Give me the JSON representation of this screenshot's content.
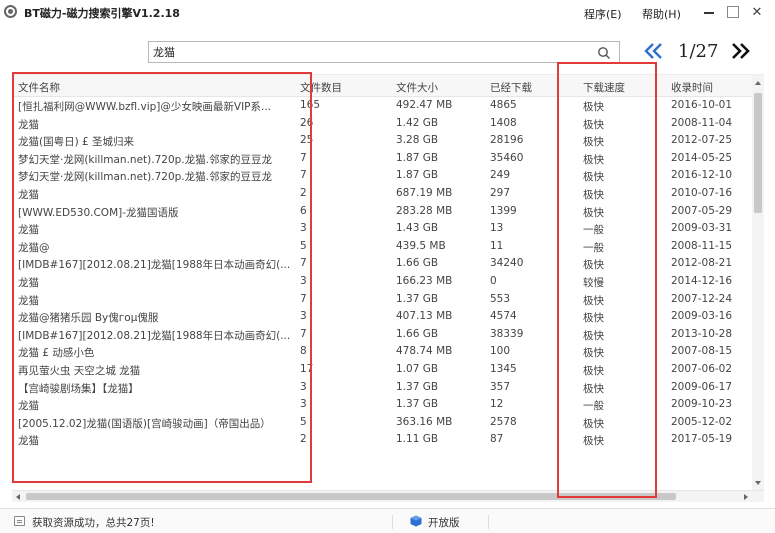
{
  "app": {
    "title": "BT磁力-磁力搜索引擎V1.2.18",
    "menu_program": "程序(E)",
    "menu_help": "帮助(H)",
    "close_glyph": "✕"
  },
  "search": {
    "value": "龙猫",
    "placeholder": ""
  },
  "pagination": {
    "label": "1/27",
    "prev_glyph": "«",
    "next_glyph": "»"
  },
  "colors": {
    "accent": "#2f6fd0",
    "annotation": "#e23a3a"
  },
  "table": {
    "headers": [
      "文件名称",
      "文件数目",
      "文件大小",
      "已经下载",
      "下载速度",
      "收录时间"
    ],
    "rows": [
      [
        "[恒扎福利网@WWW.bzfl.vip]@少女映画最新VIP系...",
        "165",
        "492.47 MB",
        "4865",
        "极快",
        "2016-10-01"
      ],
      [
        "龙猫",
        "26",
        "1.42 GB",
        "1408",
        "极快",
        "2008-11-04"
      ],
      [
        "龙猫(国粤日) £ 圣城归来",
        "25",
        "3.28 GB",
        "28196",
        "极快",
        "2012-07-25"
      ],
      [
        "梦幻天堂·龙网(killman.net).720p.龙猫.邻家的豆豆龙",
        "7",
        "1.87 GB",
        "35460",
        "极快",
        "2014-05-25"
      ],
      [
        "梦幻天堂·龙网(killman.net).720p.龙猫.邻家的豆豆龙",
        "7",
        "1.87 GB",
        "249",
        "极快",
        "2016-12-10"
      ],
      [
        "龙猫",
        "2",
        "687.19 MB",
        "297",
        "极快",
        "2010-07-16"
      ],
      [
        "[WWW.ED530.COM]-龙猫国语版",
        "6",
        "283.28 MB",
        "1399",
        "极快",
        "2007-05-29"
      ],
      [
        "龙猫",
        "3",
        "1.43 GB",
        "13",
        "一般",
        "2009-03-31"
      ],
      [
        "龙猫@",
        "5",
        "439.5 MB",
        "11",
        "一般",
        "2008-11-15"
      ],
      [
        "[IMDB#167][2012.08.21]龙猫[1988年日本动画奇幻(...",
        "7",
        "1.66 GB",
        "34240",
        "极快",
        "2012-08-21"
      ],
      [
        "龙猫",
        "3",
        "166.23 MB",
        "0",
        "较慢",
        "2014-12-16"
      ],
      [
        "龙猫",
        "7",
        "1.37 GB",
        "553",
        "极快",
        "2007-12-24"
      ],
      [
        "龙猫@猪猪乐园 By傀гоμ傀服",
        "3",
        "407.13 MB",
        "4574",
        "极快",
        "2009-03-16"
      ],
      [
        "[IMDB#167][2012.08.21]龙猫[1988年日本动画奇幻(...",
        "7",
        "1.66 GB",
        "38339",
        "极快",
        "2013-10-28"
      ],
      [
        "龙猫 £ 动感小色",
        "8",
        "478.74 MB",
        "100",
        "极快",
        "2007-08-15"
      ],
      [
        "再见萤火虫 天空之城 龙猫",
        "17",
        "1.07 GB",
        "1345",
        "极快",
        "2007-06-02"
      ],
      [
        "【宫崎骏剧场集】【龙猫】",
        "3",
        "1.37 GB",
        "357",
        "极快",
        "2009-06-17"
      ],
      [
        "龙猫",
        "3",
        "1.37 GB",
        "12",
        "一般",
        "2009-10-23"
      ],
      [
        "[2005.12.02]龙猫(国语版)[宫崎骏动画]（帝国出品）",
        "5",
        "363.16 MB",
        "2578",
        "极快",
        "2005-12-02"
      ],
      [
        "龙猫",
        "2",
        "1.11 GB",
        "87",
        "极快",
        "2017-05-19"
      ]
    ]
  },
  "status": {
    "message": "获取资源成功，总共27页!",
    "open_label": "开放版"
  }
}
